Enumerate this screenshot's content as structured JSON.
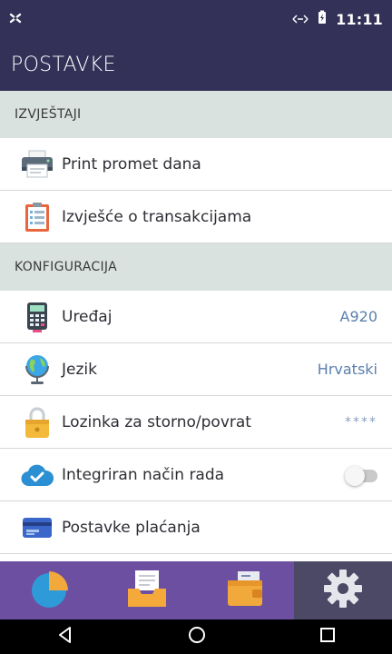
{
  "status_bar": {
    "time": "11:11"
  },
  "header": {
    "title": "POSTAVKE"
  },
  "sections": [
    {
      "title": "IZVJEŠTAJI",
      "items": [
        {
          "label": "Print promet dana",
          "icon": "printer-icon"
        },
        {
          "label": "Izvješće o transakcijama",
          "icon": "clipboard-report-icon"
        }
      ]
    },
    {
      "title": "KONFIGURACIJA",
      "items": [
        {
          "label": "Uređaj",
          "value": "A920",
          "icon": "calculator-terminal-icon"
        },
        {
          "label": "Jezik",
          "value": "Hrvatski",
          "icon": "globe-icon"
        },
        {
          "label": "Lozinka za storno/povrat",
          "value": "****",
          "icon": "padlock-icon"
        },
        {
          "label": "Integriran način rada",
          "toggle": false,
          "icon": "cloud-check-icon"
        },
        {
          "label": "Postavke plaćanja",
          "icon": "credit-card-icon"
        }
      ]
    }
  ],
  "bottom_nav": {
    "active_index": 3,
    "items": [
      "pie-chart-icon",
      "inbox-tray-icon",
      "wallet-icon",
      "settings-gear-icon"
    ]
  },
  "colors": {
    "header_bg": "#333158",
    "section_bg": "#d9e2df",
    "value_text": "#5a7fae",
    "nav_bg": "#6d4fa2",
    "nav_active_bg": "#4c4966"
  }
}
